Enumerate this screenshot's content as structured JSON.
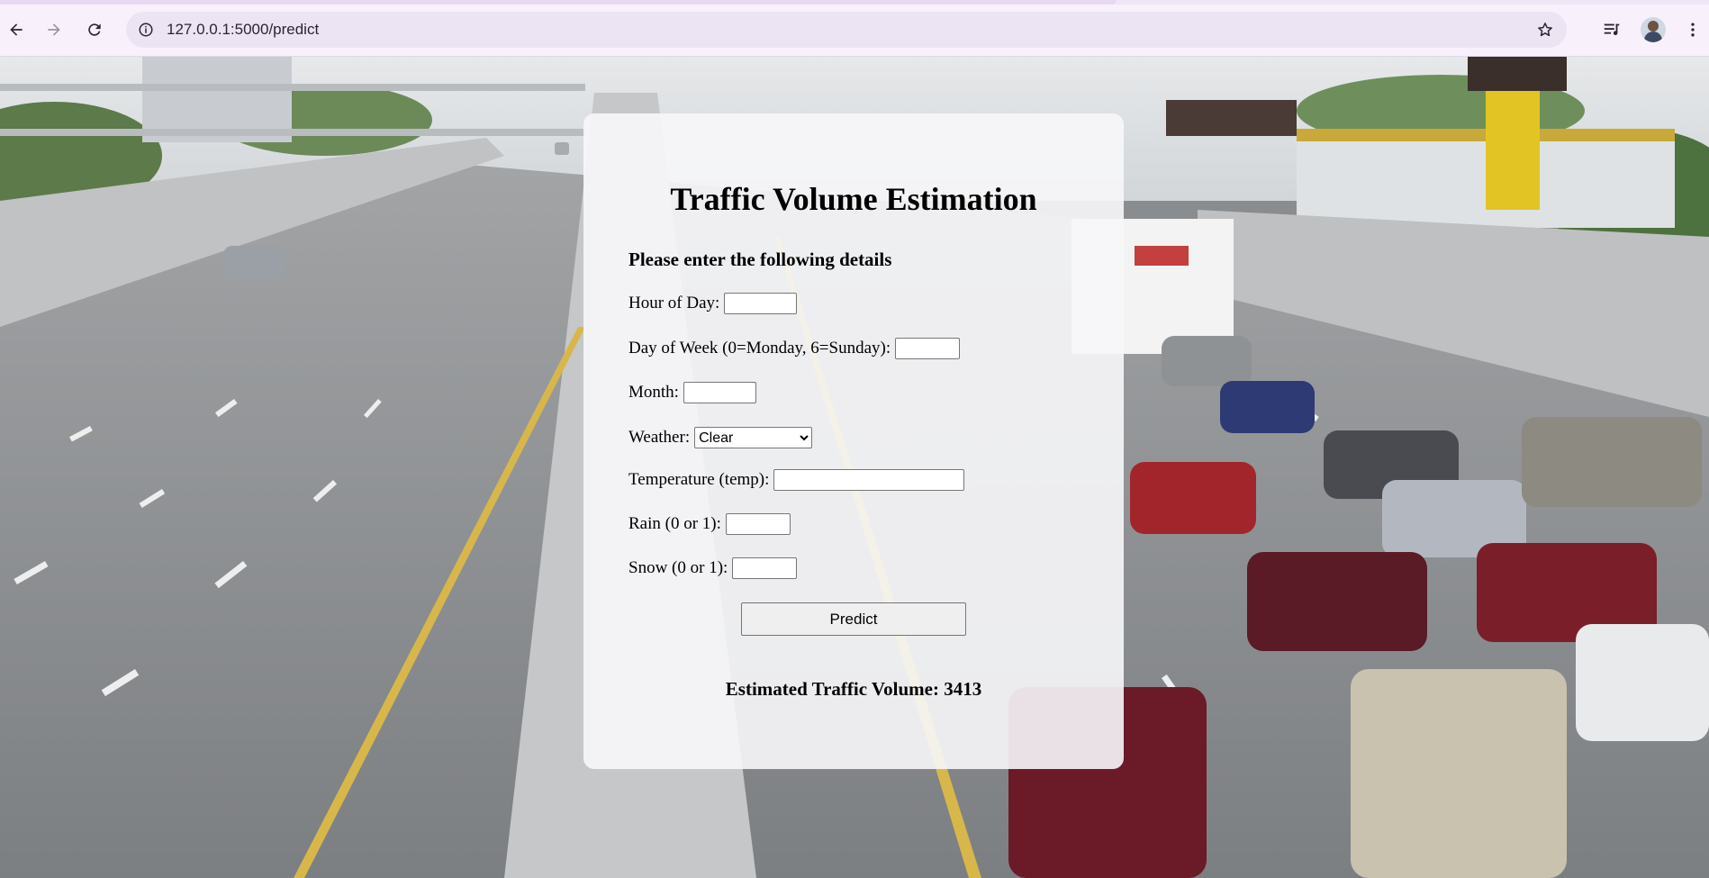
{
  "browser": {
    "url": "127.0.0.1:5000/predict",
    "icons": [
      "back-arrow-icon",
      "forward-arrow-icon",
      "reload-icon",
      "site-info-icon",
      "bookmark-star-icon",
      "media-controls-icon",
      "profile-avatar",
      "more-menu-icon"
    ]
  },
  "page": {
    "background": "highway traffic photo",
    "title": "Traffic Volume Estimation",
    "subtitle": "Please enter the following details",
    "fields": {
      "hour": {
        "label": "Hour of Day:",
        "value": ""
      },
      "day_of_week": {
        "label": "Day of Week (0=Monday, 6=Sunday):",
        "value": ""
      },
      "month": {
        "label": "Month:",
        "value": ""
      },
      "weather": {
        "label": "Weather:",
        "selected": "Clear"
      },
      "temperature": {
        "label": "Temperature (temp):",
        "value": ""
      },
      "rain": {
        "label": "Rain (0 or 1):",
        "value": ""
      },
      "snow": {
        "label": "Snow (0 or 1):",
        "value": ""
      }
    },
    "predict_label": "Predict",
    "result_text": "Estimated Traffic Volume: 3413"
  },
  "colors": {
    "chrome_bg": "#f8f1fb",
    "omnibox_bg": "#ece4f2",
    "card_bg": "#f7f7f9"
  }
}
